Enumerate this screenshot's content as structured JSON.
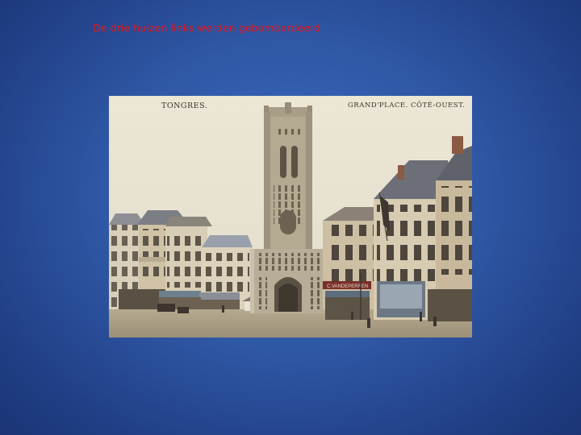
{
  "slide": {
    "caption": "De drie huizen links werden gebombardeerd",
    "caption_color": "#e8151b",
    "background_color": "#2f58a6"
  },
  "photo": {
    "kind": "vintage tinted postcard",
    "title_left": "TONGRES.",
    "title_right": "GRAND'PLACE. CÔTÉ-OUEST.",
    "shop_sign": "C.VANDEPERREN"
  }
}
